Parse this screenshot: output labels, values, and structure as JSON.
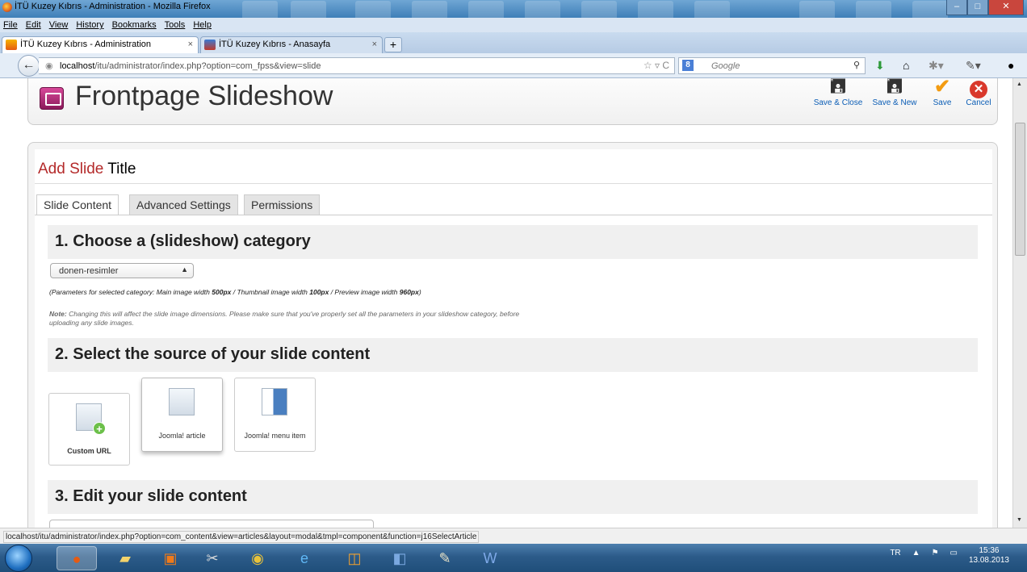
{
  "window": {
    "title": "İTÜ Kuzey Kıbrıs - Administration - Mozilla Firefox"
  },
  "menubar": {
    "items": [
      "File",
      "Edit",
      "View",
      "History",
      "Bookmarks",
      "Tools",
      "Help"
    ]
  },
  "tabs": [
    {
      "label": "İTÜ Kuzey Kıbrıs - Administration"
    },
    {
      "label": "İTÜ Kuzey Kıbrıs - Anasayfa"
    }
  ],
  "navbar": {
    "url_host": "localhost",
    "url_path": "/itu/administrator/index.php?option=com_fpss&view=slide",
    "search_placeholder": "Google"
  },
  "header": {
    "title": "Frontpage Slideshow",
    "buttons": [
      {
        "label": "Save & Close",
        "icon": "disk-icon"
      },
      {
        "label": "Save & New",
        "icon": "disk-icon"
      },
      {
        "label": "Save",
        "icon": "check-icon",
        "color": "#f39c12"
      },
      {
        "label": "Cancel",
        "icon": "cancel-icon",
        "color": "#d9382b"
      }
    ]
  },
  "form": {
    "heading_red": "Add Slide",
    "heading_black": "Title",
    "tabs": [
      "Slide Content",
      "Advanced Settings",
      "Permissions"
    ],
    "sections": [
      "1. Choose a (slideshow) category",
      "2. Select the source of your slide content",
      "3. Edit your slide content"
    ],
    "category_select": "donen-resimler",
    "params_prefix": "(Parameters for selected category: Main image width ",
    "params_main": "500px",
    "params_thumb_prefix": " / Thumbnail image width ",
    "params_thumb": "100px",
    "params_prev_prefix": " / Preview image width ",
    "params_prev": "960px",
    "params_suffix": ")",
    "note_label": "Note:",
    "note_text": " Changing this will affect the slide image dimensions. Please make sure that you've properly set all the parameters in your slideshow category, before uploading any slide images.",
    "sources": [
      {
        "label": "Custom URL"
      },
      {
        "label": "Joomla! article"
      },
      {
        "label": "Joomla! menu item"
      }
    ]
  },
  "status": {
    "text": "localhost/itu/administrator/index.php?option=com_content&view=articles&layout=modal&tmpl=component&function=j16SelectArticle"
  },
  "taskbar": {
    "lang": "TR",
    "time": "15:36",
    "date": "13.08.2013"
  }
}
